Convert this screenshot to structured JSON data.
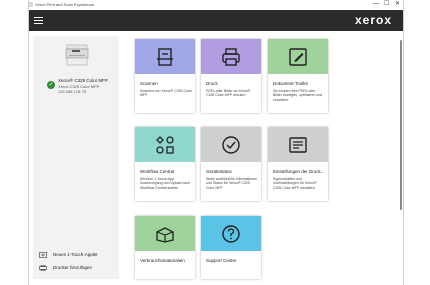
{
  "window": {
    "title": "Xerox Print and Scan Experience",
    "controls": [
      "—",
      "☐",
      "✕"
    ]
  },
  "header": {
    "menu_icon": "hamburger-icon",
    "brand": "xerox"
  },
  "device": {
    "name": "Xerox® C325 Color MFP",
    "model": "Xerox C325 Color MFP",
    "ip": "192.168.178.75",
    "status_icon": "check-circle-icon",
    "status_color": "#2e8b2e"
  },
  "sidebar_links": [
    {
      "label": "Neues 1-Touch-Applet",
      "icon": "applet-add-icon"
    },
    {
      "label": "Drucker hinzufügen",
      "icon": "printer-add-icon"
    }
  ],
  "tiles": [
    {
      "title": "Scannen",
      "desc": "Scannen von Xerox® C325 Color MFP",
      "color": "#9fa7e6",
      "icon": "scanner-icon"
    },
    {
      "title": "Druck",
      "desc": "PDFs oder Bilder an Xerox® C325 Color MFP drucken",
      "color": "#b19ee0",
      "icon": "printer-icon"
    },
    {
      "title": "Dokument-Toolkit",
      "desc": "Sie können Ihre PDFs oder Bilder anzeigen, optimieren und verwalten.",
      "color": "#9ed29a",
      "icon": "edit-document-icon"
    },
    {
      "title": "Workflow Central",
      "desc": "Mit einer 1-Touch-App Scannvorgang und Upload nach Workflow Central starten",
      "color": "#8fd6cf",
      "icon": "workflow-icon"
    },
    {
      "title": "Gerätestatus",
      "desc": "Siehe ausführliche Informationen und Status für Xerox® C325 Color MFP",
      "color": "#cfcfcf",
      "icon": "check-circle-icon"
    },
    {
      "title": "Einstellungen der Druck...",
      "desc": "Eigenschaften und Voreinstellungen für Xerox® C325 Color MFP verwalten",
      "color": "#cfcfcf",
      "icon": "settings-list-icon"
    },
    {
      "title": "Verbrauchsmaterialien",
      "desc": "",
      "color": "#9ed29a",
      "icon": "supplies-box-icon"
    },
    {
      "title": "Support Center",
      "desc": "",
      "color": "#5bc3e6",
      "icon": "help-icon"
    }
  ]
}
